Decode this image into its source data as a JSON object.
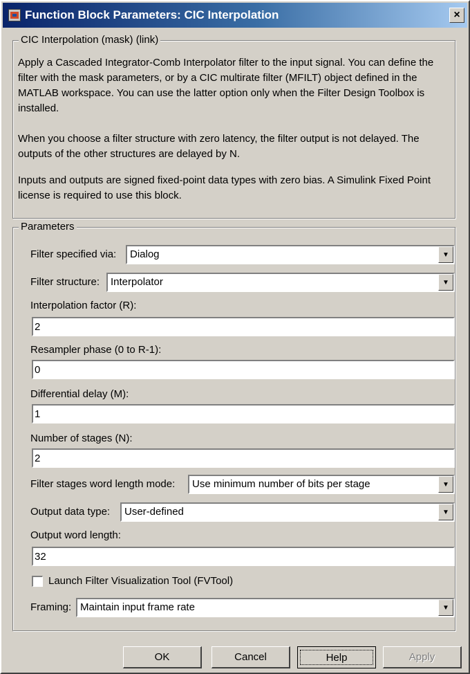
{
  "window": {
    "title": "Function Block Parameters: CIC Interpolation",
    "close_glyph": "×"
  },
  "description_group": {
    "legend": "CIC Interpolation (mask) (link)",
    "paragraphs": [
      "Apply a Cascaded Integrator-Comb Interpolator filter to the input signal. You can define the filter with the mask parameters, or by a CIC multirate filter (MFILT) object defined in the MATLAB workspace. You can use the latter option only when the Filter Design Toolbox is installed.",
      "When you choose a filter structure with zero latency, the filter output is not delayed. The outputs of the other structures are delayed by N.",
      "Inputs and outputs are signed fixed-point data types with zero bias.  A Simulink Fixed Point license is required to use this block."
    ]
  },
  "parameters_group": {
    "legend": "Parameters",
    "filter_specified_via": {
      "label": "Filter specified via:",
      "value": "Dialog"
    },
    "filter_structure": {
      "label": "Filter structure:",
      "value": "Interpolator"
    },
    "interpolation_factor": {
      "label": "Interpolation factor (R):",
      "value": "2"
    },
    "resampler_phase": {
      "label": "Resampler phase (0 to R-1):",
      "value": "0"
    },
    "differential_delay": {
      "label": "Differential delay (M):",
      "value": "1"
    },
    "number_of_stages": {
      "label": "Number of stages (N):",
      "value": "2"
    },
    "word_length_mode": {
      "label": "Filter stages word length mode:",
      "value": "Use minimum number of bits per stage"
    },
    "output_data_type": {
      "label": "Output data type:",
      "value": "User-defined"
    },
    "output_word_length": {
      "label": "Output word length:",
      "value": "32"
    },
    "launch_fvtool": {
      "label": "Launch Filter Visualization Tool (FVTool)",
      "checked": false
    },
    "framing": {
      "label": "Framing:",
      "value": "Maintain input frame rate"
    }
  },
  "buttons": {
    "ok": "OK",
    "cancel": "Cancel",
    "help": "Help",
    "apply": "Apply"
  }
}
